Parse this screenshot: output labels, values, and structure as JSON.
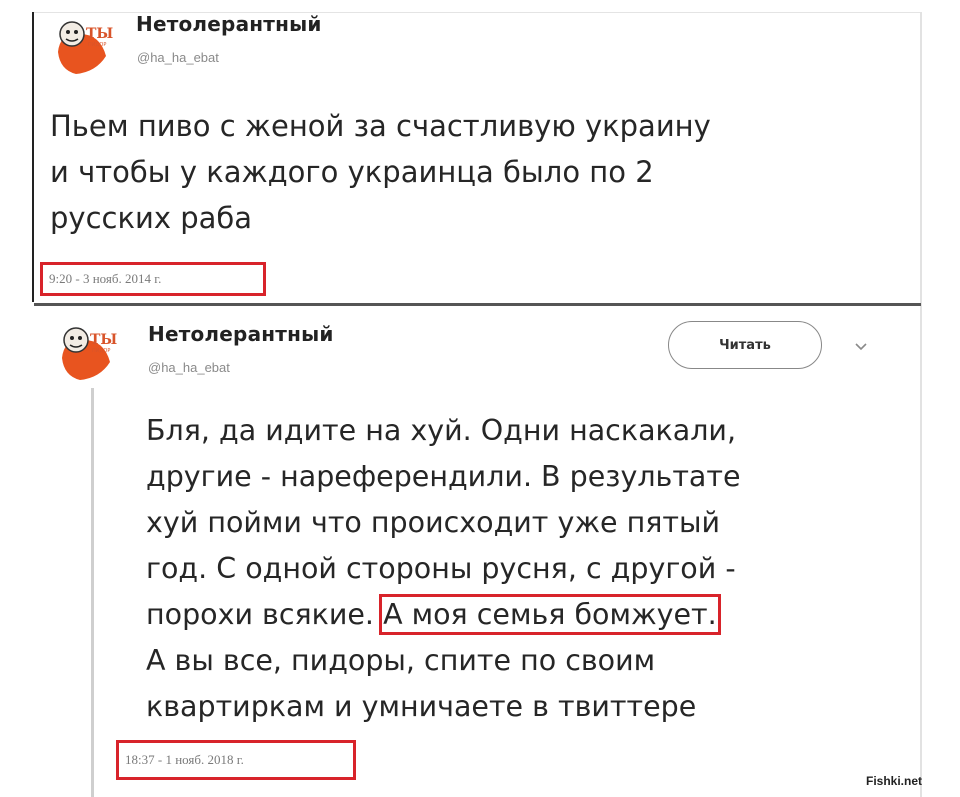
{
  "tweet1": {
    "author_name": "Нетолерантный",
    "handle": "@ha_ha_ebat",
    "text_lines": [
      "Пьем пиво с женой за счастливую украину",
      "и чтобы у каждого украинца было по 2",
      "русских раба"
    ],
    "timestamp": "9:20 - 3 нояб. 2014 г."
  },
  "tweet2": {
    "author_name": "Нетолерантный",
    "handle": "@ha_ha_ebat",
    "follow_label": "Читать",
    "icons": {
      "more": "chevron-down-icon"
    },
    "text_lines": [
      "Бля, да идите на хуй. Одни наскакали,",
      "другие - нареферендили. В результате",
      "хуй пойми что происходит уже пятый",
      "год. С одной стороны русня, с другой -",
      "порохи всякие."
    ],
    "highlighted": "А моя семья бомжует.",
    "text_lines_after": [
      "А вы все, пидоры, спите по своим",
      "квартиркам и умничаете в твиттере"
    ],
    "timestamp": "18:37 - 1 нояб. 2018 г."
  },
  "watermark": "Fishki.net",
  "colors": {
    "highlight": "#d8232a",
    "text": "#262626",
    "muted": "#8a8a8a"
  }
}
